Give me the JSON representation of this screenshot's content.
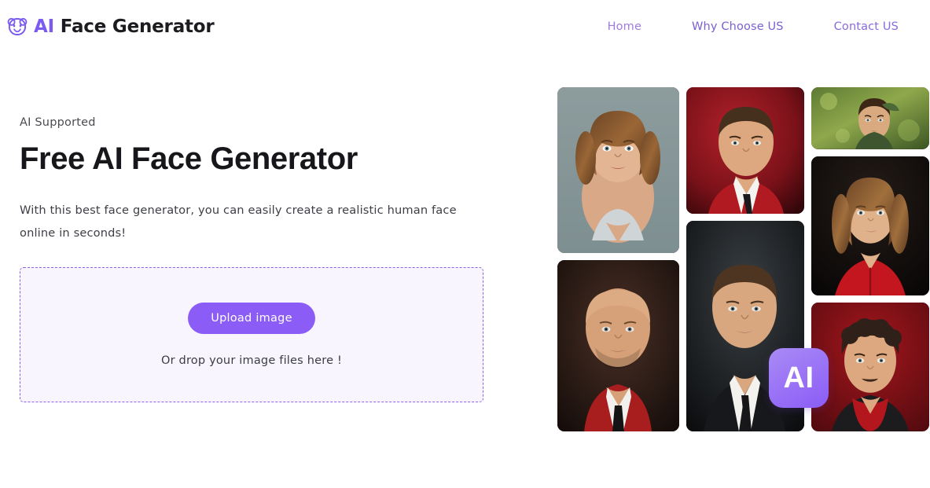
{
  "brand": {
    "icon": "bear-face-icon",
    "text_accent": "AI",
    "text_rest": " Face Generator",
    "accent_color": "#7c5cf0"
  },
  "nav": {
    "items": [
      {
        "label": "Home",
        "color": "#9f7ae0"
      },
      {
        "label": "Why Choose US",
        "color": "#7b5fd4"
      },
      {
        "label": "Contact US",
        "color": "#8a6ae0"
      }
    ]
  },
  "hero": {
    "eyebrow": "AI Supported",
    "headline": "Free AI Face Generator",
    "subtext": "With this best face generator, you can easily create a realistic human face online in seconds!"
  },
  "dropzone": {
    "upload_button": "Upload image",
    "drop_hint": "Or drop your image files here !",
    "border_color": "#8b62e8",
    "fill_color": "#f8f5ff",
    "button_color": "#8b5cf6"
  },
  "gallery": {
    "badge_label": "AI",
    "badge_color": "#8b5cf6",
    "images": [
      {
        "id": "portrait-woman-curly-hair",
        "alt": "Woman with curly brown hair in grey tank top",
        "column": 1
      },
      {
        "id": "portrait-bald-man-red-jacket",
        "alt": "Bald man in red jacket with black tie",
        "column": 1
      },
      {
        "id": "portrait-man-red-background",
        "alt": "Man in red jacket on red background",
        "column": 2
      },
      {
        "id": "portrait-man-dark-suit",
        "alt": "Man in dark suit on dark background",
        "column": 2
      },
      {
        "id": "portrait-fantasy-young-man",
        "alt": "Young man in green forest fantasy scene",
        "column": 3
      },
      {
        "id": "portrait-woman-red-blouse",
        "alt": "Woman with wavy hair in red blouse",
        "column": 3
      },
      {
        "id": "portrait-man-curly-red-shirt",
        "alt": "Man with curly hair in red shirt",
        "column": 3
      }
    ]
  }
}
